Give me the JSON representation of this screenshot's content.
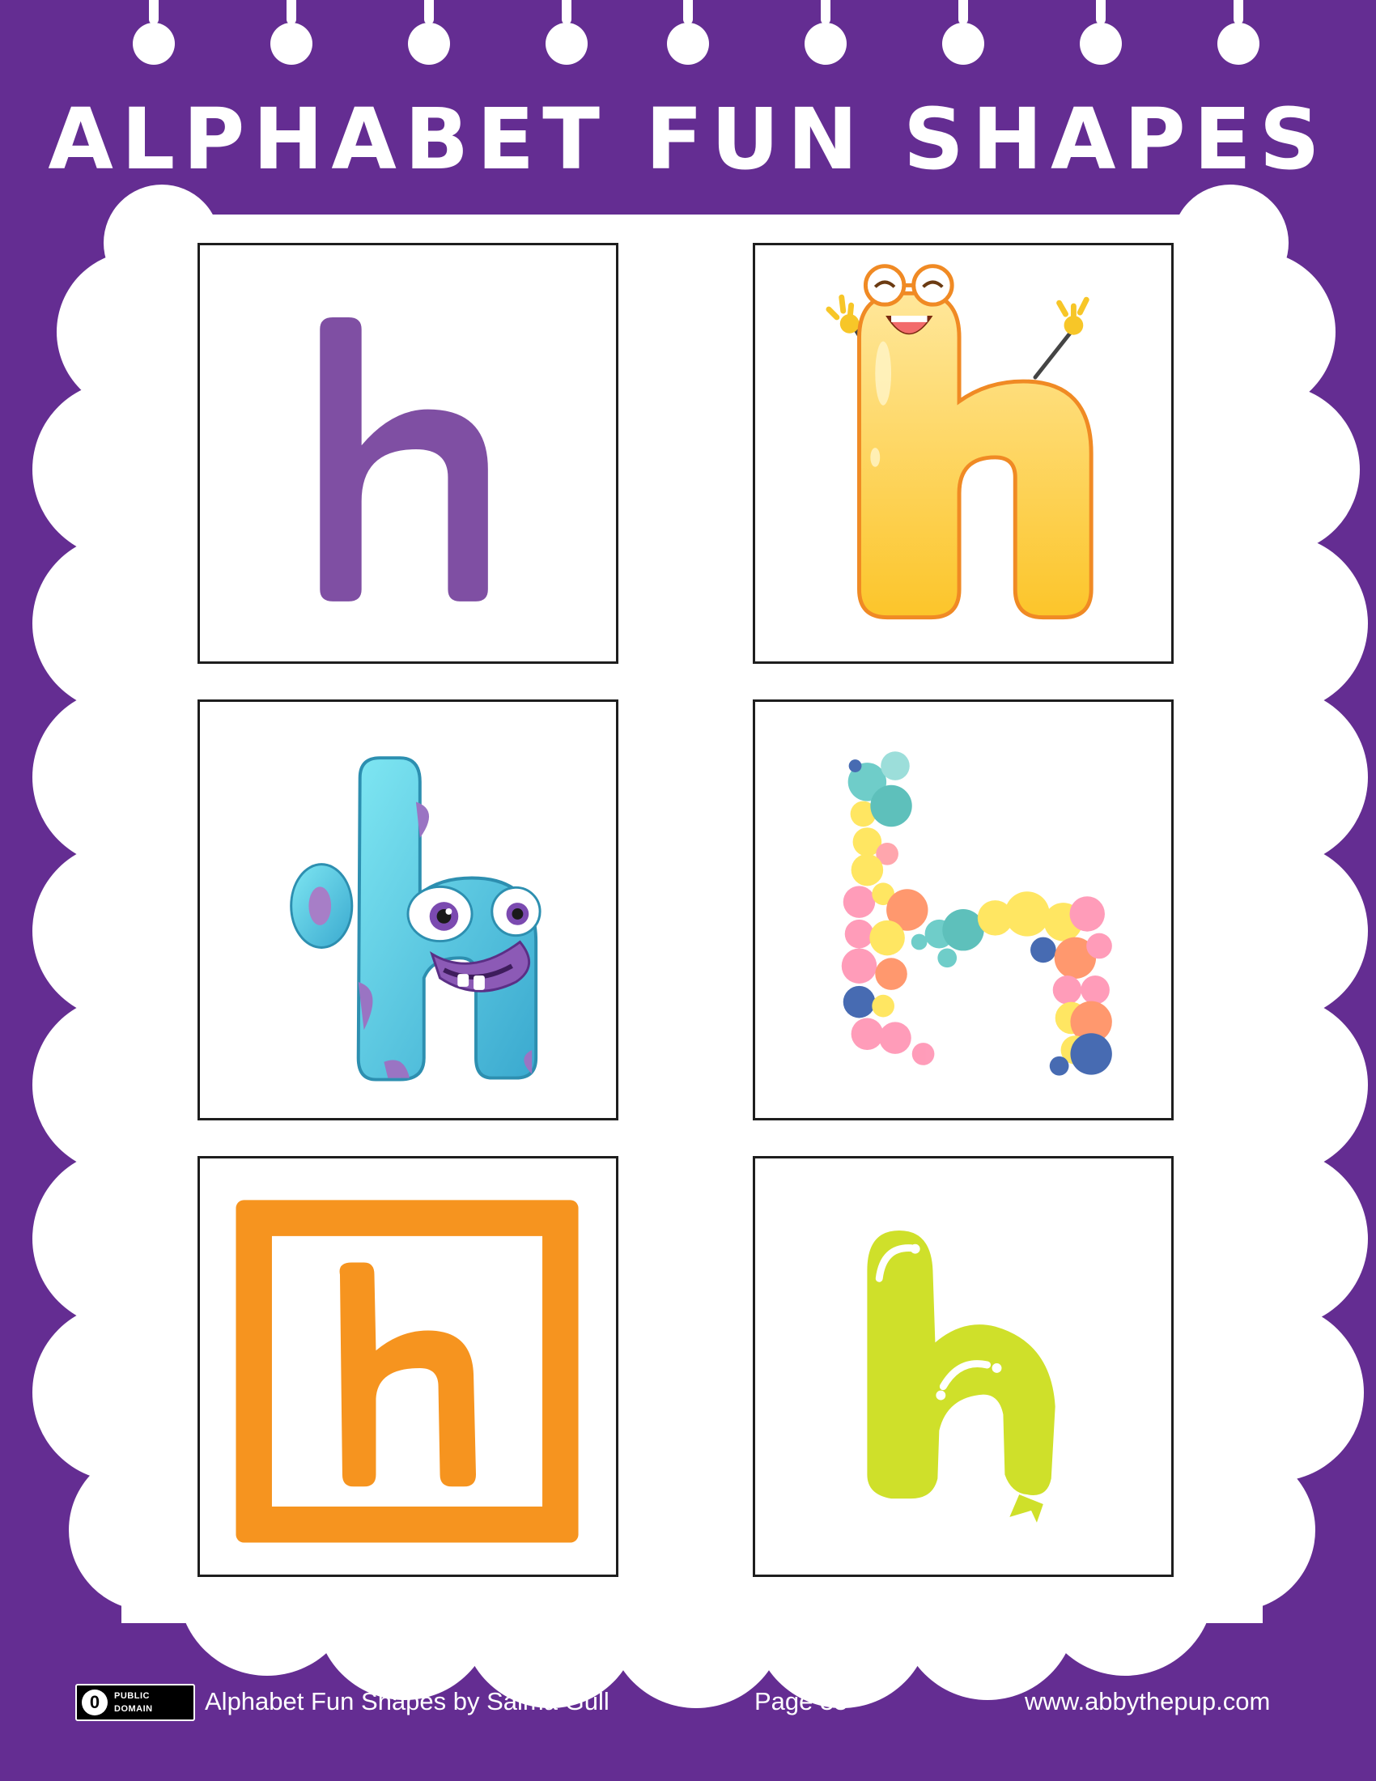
{
  "colors": {
    "background": "#642d92",
    "purple_letter": "#7f4fa3",
    "orange": "#f6941f",
    "lime": "#cfe02a"
  },
  "header": {
    "title": "ALPHABET FUN SHAPES"
  },
  "cards": [
    {
      "letter": "h",
      "style": "plain-purple"
    },
    {
      "letter": "h",
      "style": "happy-yellow-character"
    },
    {
      "letter": "h",
      "style": "blue-monster"
    },
    {
      "letter": "h",
      "style": "bubbles"
    },
    {
      "letter": "h",
      "style": "orange-block"
    },
    {
      "letter": "h",
      "style": "lime-balloon"
    }
  ],
  "footer": {
    "license_line1": "PUBLIC",
    "license_line2": "DOMAIN",
    "license_symbol": "0",
    "credit": "Alphabet Fun Shapes by Salma Gull",
    "page": "Page 35",
    "website": "www.abbythepup.com"
  }
}
